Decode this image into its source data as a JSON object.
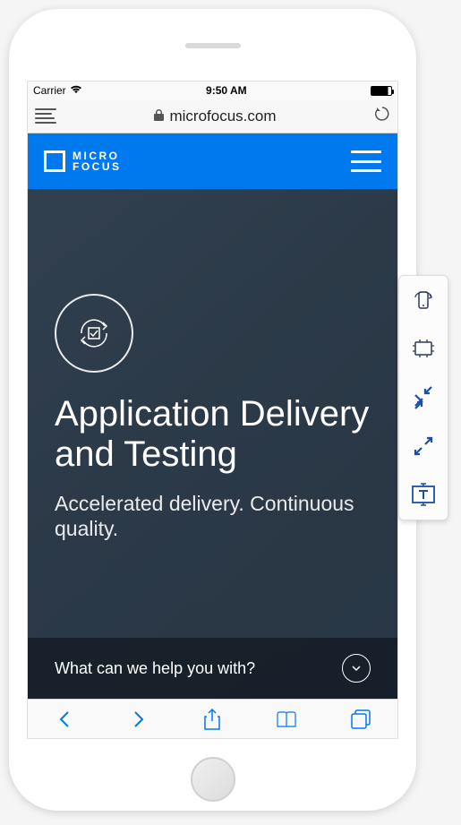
{
  "status": {
    "carrier": "Carrier",
    "time": "9:50 AM"
  },
  "browser": {
    "domain": "microfocus.com"
  },
  "header": {
    "logo_line1": "MICRO",
    "logo_line2": "FOCUS"
  },
  "hero": {
    "title": "Application Delivery and Testing",
    "subtitle": "Accelerated delivery. Continuous quality."
  },
  "help": {
    "prompt": "What can we help you with?"
  }
}
